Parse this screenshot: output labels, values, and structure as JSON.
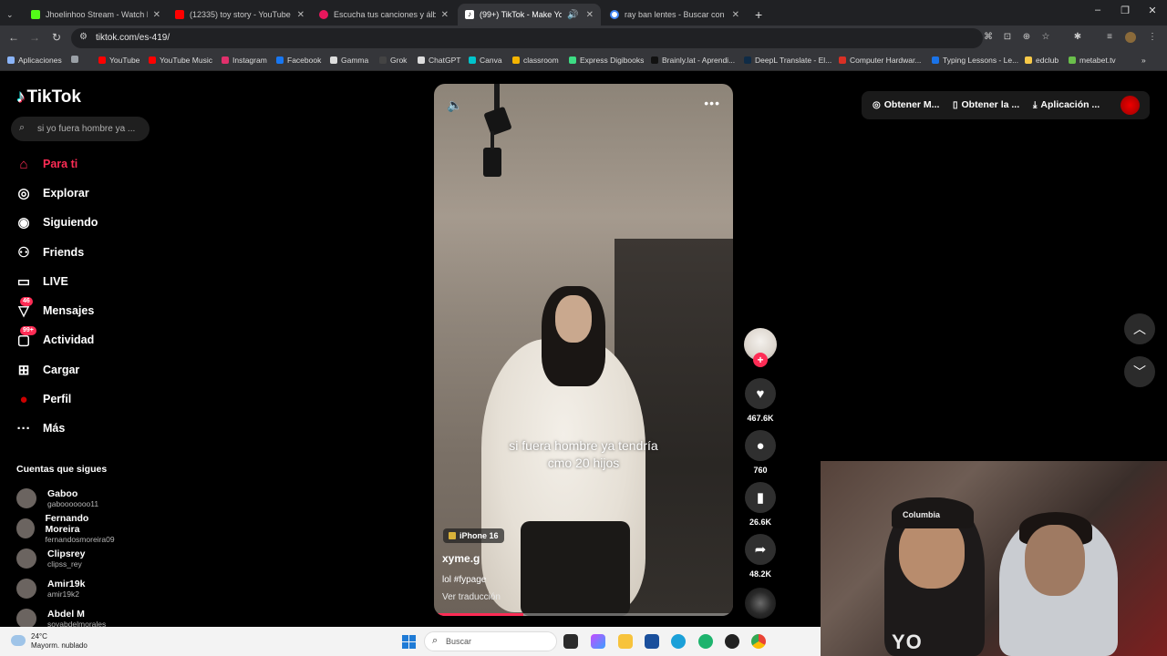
{
  "browser": {
    "tabs": [
      {
        "title": "Jhoelinhoo Stream - Watch Live",
        "color": "#53fc18",
        "active": false
      },
      {
        "title": "(12335) toy story - YouTube",
        "color": "#ff0000",
        "active": false
      },
      {
        "title": "Escucha tus canciones y álbum",
        "color": "#e8175d",
        "active": false
      },
      {
        "title": "(99+) TikTok - Make Your Da",
        "color": "#111111",
        "active": true
      },
      {
        "title": "ray ban lentes - Buscar con Go",
        "color": "#4285f4",
        "active": false
      }
    ],
    "new_tab": "+",
    "url": "tiktok.com/es-419/",
    "bookmarks": [
      {
        "label": "Aplicaciones",
        "color": "#8ab4f8"
      },
      {
        "label": "",
        "color": "#9aa0a6"
      },
      {
        "label": "YouTube",
        "color": "#ff0000"
      },
      {
        "label": "YouTube Music",
        "color": "#ff0000"
      },
      {
        "label": "Instagram",
        "color": "#e1306c"
      },
      {
        "label": "Facebook",
        "color": "#1877f2"
      },
      {
        "label": "Gamma",
        "color": "#dddddd"
      },
      {
        "label": "Grok",
        "color": "#444444"
      },
      {
        "label": "ChatGPT",
        "color": "#dddddd"
      },
      {
        "label": "Canva",
        "color": "#00c4cc"
      },
      {
        "label": "classroom",
        "color": "#f4b400"
      },
      {
        "label": "Express Digibooks",
        "color": "#3ddc84"
      },
      {
        "label": "Brainly.lat - Aprendi...",
        "color": "#111111"
      },
      {
        "label": "DeepL Translate - El...",
        "color": "#0f2b46"
      },
      {
        "label": "Computer Hardwar...",
        "color": "#d93025"
      },
      {
        "label": "Typing Lessons - Le...",
        "color": "#1a73e8"
      },
      {
        "label": "edclub",
        "color": "#f7c948"
      },
      {
        "label": "metabet.tv",
        "color": "#6abf4b"
      }
    ]
  },
  "tiktok": {
    "logo": "TikTok",
    "search_placeholder": "si yo fuera hombre ya ...",
    "nav": [
      {
        "label": "Para ti",
        "icon": "home-icon",
        "active": true,
        "badge": ""
      },
      {
        "label": "Explorar",
        "icon": "compass-icon",
        "active": false,
        "badge": ""
      },
      {
        "label": "Siguiendo",
        "icon": "following-icon",
        "active": false,
        "badge": ""
      },
      {
        "label": "Friends",
        "icon": "friends-icon",
        "active": false,
        "badge": ""
      },
      {
        "label": "LIVE",
        "icon": "live-icon",
        "active": false,
        "badge": ""
      },
      {
        "label": "Mensajes",
        "icon": "messages-icon",
        "active": false,
        "badge": "46"
      },
      {
        "label": "Actividad",
        "icon": "activity-icon",
        "active": false,
        "badge": "99+"
      },
      {
        "label": "Cargar",
        "icon": "upload-icon",
        "active": false,
        "badge": ""
      },
      {
        "label": "Perfil",
        "icon": "profile-icon",
        "active": false,
        "badge": ""
      },
      {
        "label": "Más",
        "icon": "more-icon",
        "active": false,
        "badge": ""
      }
    ],
    "following_title": "Cuentas que sigues",
    "following": [
      {
        "name": "Gaboo",
        "username": "gabooooooo11"
      },
      {
        "name": "Fernando Moreira",
        "username": "fernandosmoreira09"
      },
      {
        "name": "Clipsrey",
        "username": "clipss_rey"
      },
      {
        "name": "Amir19k",
        "username": "amir19k2"
      },
      {
        "name": "Abdel M",
        "username": "soyabdelmorales"
      }
    ],
    "video": {
      "caption_line1": "si fuera hombre ya tendría",
      "caption_line2": "cmo 20 hijos",
      "device_tag": "iPhone 16",
      "author": "xyme.g",
      "description": "lol #fypage",
      "translate": "Ver traducción",
      "progress": 0.3
    },
    "actions": {
      "likes": "467.6K",
      "comments": "760",
      "saves": "26.6K",
      "shares": "48.2K"
    },
    "top_buttons": [
      {
        "label": "Obtener M...",
        "icon": "coin-icon"
      },
      {
        "label": "Obtener la ...",
        "icon": "phone-icon"
      },
      {
        "label": "Aplicación ...",
        "icon": "download-icon"
      }
    ]
  },
  "webcam": {
    "cap_text": "Columbia",
    "shirt_text": "YO"
  },
  "taskbar": {
    "temperature": "24°C",
    "weather": "Mayorm. nublado",
    "search_placeholder": "Buscar"
  }
}
